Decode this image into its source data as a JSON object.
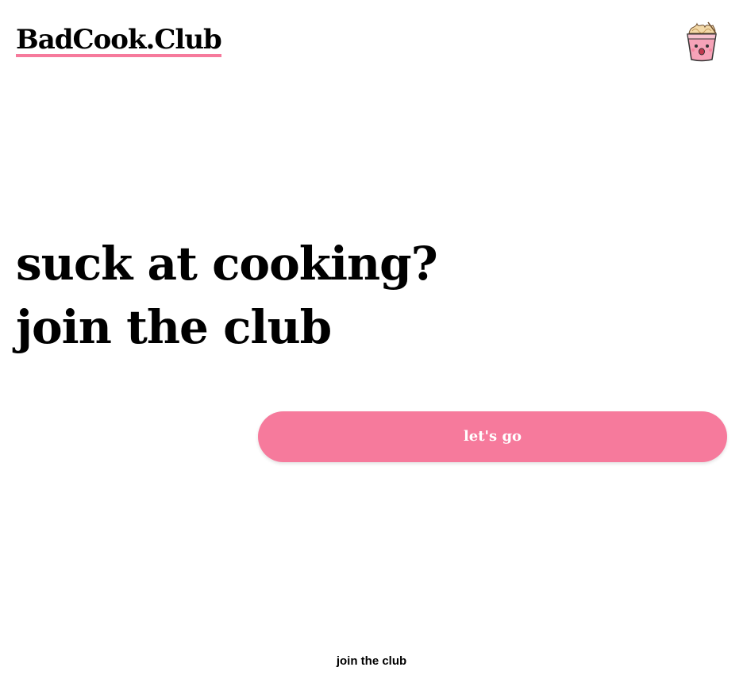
{
  "header": {
    "logo_text": "BadCook.Club",
    "mascot_icon": "noodle-cup-mascot-icon"
  },
  "hero": {
    "line1": "suck at cooking?",
    "line2": "join the club"
  },
  "cta": {
    "label": "let's go"
  },
  "footer": {
    "link_text": "join the club"
  },
  "colors": {
    "accent": "#f67a9c",
    "text": "#000000",
    "background": "#ffffff"
  }
}
